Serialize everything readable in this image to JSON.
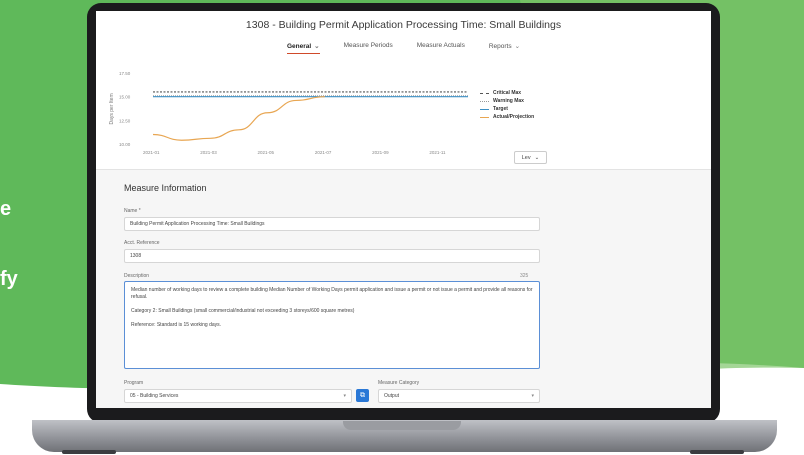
{
  "promo": {
    "side_text": [
      "e",
      "fy"
    ],
    "colors": {
      "green_light": "#8fcc6e",
      "green_dark": "#4caf50"
    }
  },
  "app": {
    "title": "1308 - Building Permit Application Processing Time: Small Buildings",
    "tabs": [
      {
        "label": "General",
        "active": true,
        "has_dropdown": true
      },
      {
        "label": "Measure Periods",
        "active": false,
        "has_dropdown": false
      },
      {
        "label": "Measure Actuals",
        "active": false,
        "has_dropdown": false
      },
      {
        "label": "Reports",
        "active": false,
        "has_dropdown": true
      }
    ],
    "accent_color": "#d04a2a",
    "level_select": {
      "value": "Lev"
    }
  },
  "chart_data": {
    "type": "line",
    "ylabel": "Days per Item",
    "y_ticks": [
      "17.50",
      "15.00",
      "12.50",
      "10.00"
    ],
    "x_ticks": [
      "2021-01",
      "2021-03",
      "2021-05",
      "2021-07",
      "2021-09",
      "2021-11"
    ],
    "ylim": [
      10,
      17.5
    ],
    "legend_position": "right",
    "series": [
      {
        "name": "Critical Max",
        "style": "dashed",
        "color": "#555555",
        "x": [
          "2021-01",
          "2021-02",
          "2021-03",
          "2021-04",
          "2021-05",
          "2021-06",
          "2021-07",
          "2021-08",
          "2021-09",
          "2021-10",
          "2021-11",
          "2021-12"
        ],
        "y": [
          15.5,
          15.5,
          15.5,
          15.5,
          15.5,
          15.5,
          15.5,
          15.5,
          15.5,
          15.5,
          15.5,
          15.5
        ]
      },
      {
        "name": "Warning Max",
        "style": "dotted",
        "color": "#9a9a9a",
        "x": [
          "2021-01",
          "2021-02",
          "2021-03",
          "2021-04",
          "2021-05",
          "2021-06",
          "2021-07",
          "2021-08",
          "2021-09",
          "2021-10",
          "2021-11",
          "2021-12"
        ],
        "y": [
          15.1,
          15.1,
          15.1,
          15.1,
          15.1,
          15.1,
          15.1,
          15.1,
          15.1,
          15.1,
          15.1,
          15.1
        ]
      },
      {
        "name": "Target",
        "style": "solid",
        "color": "#3c8fc4",
        "x": [
          "2021-01",
          "2021-02",
          "2021-03",
          "2021-04",
          "2021-05",
          "2021-06",
          "2021-07",
          "2021-08",
          "2021-09",
          "2021-10",
          "2021-11",
          "2021-12"
        ],
        "y": [
          15.0,
          15.0,
          15.0,
          15.0,
          15.0,
          15.0,
          15.0,
          15.0,
          15.0,
          15.0,
          15.0,
          15.0
        ]
      },
      {
        "name": "Actual/Projection",
        "style": "solid",
        "color": "#e8a652",
        "x": [
          "2021-01",
          "2021-02",
          "2021-03",
          "2021-04",
          "2021-05",
          "2021-06",
          "2021-07"
        ],
        "y": [
          11.0,
          10.4,
          10.6,
          11.5,
          13.3,
          14.6,
          15.0
        ]
      }
    ]
  },
  "form": {
    "section_title": "Measure Information",
    "name": {
      "label": "Name *",
      "value": "Building Permit Application Processing Time: Small Buildings"
    },
    "acct_reference": {
      "label": "Acct. Reference",
      "value": "1308"
    },
    "description": {
      "label": "Description",
      "counter": "325",
      "lines": [
        "Median number of working days to review a complete building Median Number of Working Days permit application and issue a permit or not issue a permit and provide all reasons for refusal.",
        "Category 2: Small Buildings (small commercial/industrial not exceeding 3 storeys/600 square metres)",
        "Reference: Standard is 15 working days."
      ]
    },
    "program": {
      "label": "Program",
      "value": "05 - Building Services"
    },
    "measure_category": {
      "label": "Measure Category",
      "value": "Output"
    }
  }
}
